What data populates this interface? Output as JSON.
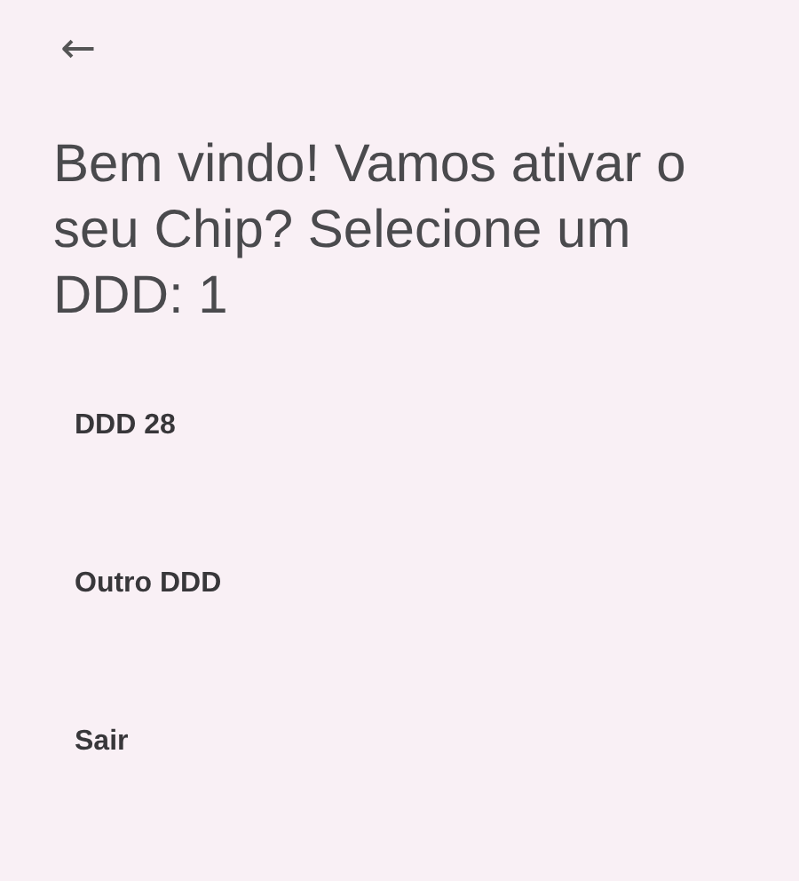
{
  "header": {
    "back": "←"
  },
  "heading": "Bem vindo! Vamos ativar o seu Chip? Selecione um DDD: 1",
  "options": [
    {
      "label": "DDD 28"
    },
    {
      "label": "Outro DDD"
    },
    {
      "label": "Sair"
    }
  ]
}
